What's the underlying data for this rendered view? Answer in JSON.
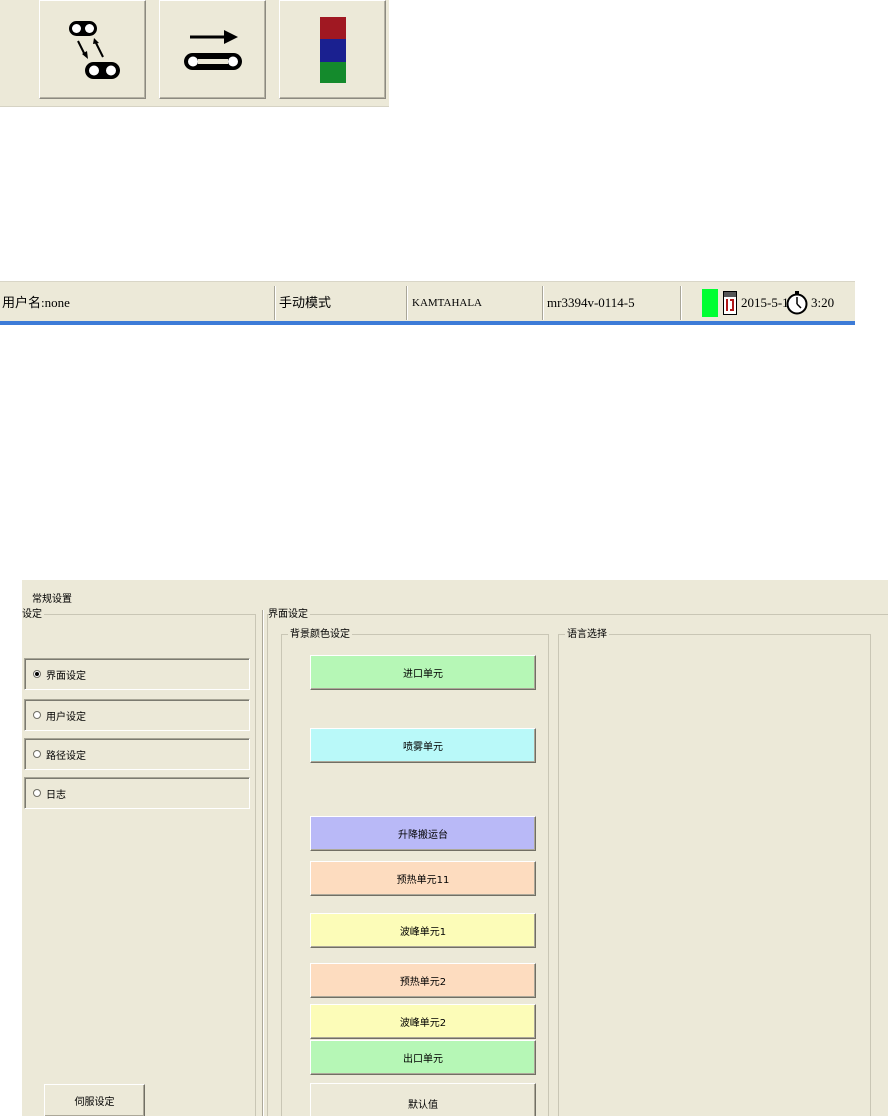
{
  "toolbar": {
    "buttons": [
      {
        "icon": "transfer-conveyor-icon"
      },
      {
        "icon": "conveyor-forward-icon"
      },
      {
        "icon": "color-stack-icon",
        "colors": [
          "#a01822",
          "#1a2090",
          "#148a2c"
        ]
      }
    ]
  },
  "statusbar": {
    "user": "用户名:none",
    "mode": "手动模式",
    "machine": "KAMTAHALA",
    "version": "mr3394v-0114-5",
    "status_color": "#00ff33",
    "date": "2015-5-15",
    "time": "3:20"
  },
  "panel": {
    "title": "常规设置",
    "settings_group": "设定",
    "radios": [
      {
        "label": "界面设定",
        "checked": true
      },
      {
        "label": "用户设定",
        "checked": false
      },
      {
        "label": "路径设定",
        "checked": false
      },
      {
        "label": "日志",
        "checked": false
      }
    ],
    "servo_button": "伺服设定",
    "interface_group": "界面设定",
    "bg_group": "背景颜色设定",
    "lang_group": "语言选择",
    "color_buttons": [
      {
        "label": "进口单元",
        "color": "#b6f7b6"
      },
      {
        "label": "喷雾单元",
        "color": "#b9f9f9"
      },
      {
        "label": "升降搬运台",
        "color": "#b9b9f7"
      },
      {
        "label": "预热单元11",
        "color": "#fddcbf"
      },
      {
        "label": "波峰单元1",
        "color": "#fcfcb8"
      },
      {
        "label": "预热单元2",
        "color": "#fddcbf"
      },
      {
        "label": "波峰单元2",
        "color": "#fcfcb8"
      },
      {
        "label": "出口单元",
        "color": "#b6f7b6"
      }
    ],
    "default_button": "默认值"
  }
}
